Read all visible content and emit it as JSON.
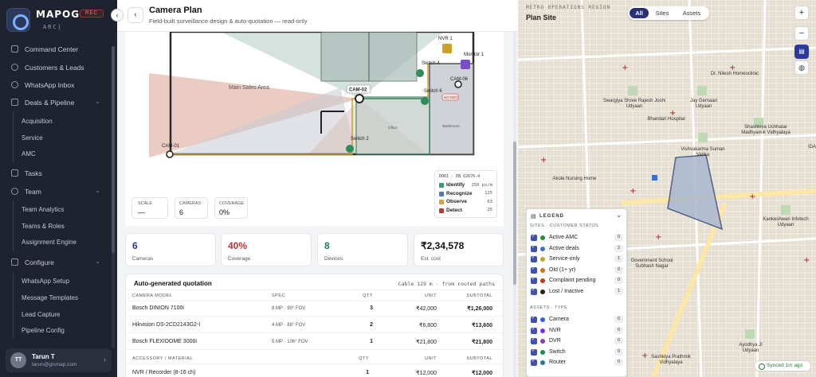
{
  "brand": {
    "name": "MAPOG",
    "badge": "REC",
    "sub": "ARC|"
  },
  "sidebar": {
    "items": [
      {
        "label": "Command Center"
      },
      {
        "label": "Customers & Leads"
      },
      {
        "label": "WhatsApp Inbox"
      },
      {
        "label": "Deals & Pipeline"
      },
      {
        "label": "Tasks"
      },
      {
        "label": "Team"
      },
      {
        "label": "Configure"
      }
    ],
    "deals_sub": [
      "Acquisition",
      "Service",
      "AMC"
    ],
    "team_sub": [
      "Team Analytics",
      "Teams & Roles",
      "Assignment Engine"
    ],
    "configure_sub": [
      "WhatsApp Setup",
      "Message Templates",
      "Lead Capture",
      "Pipeline Config"
    ]
  },
  "user": {
    "initials": "TT",
    "name": "Tarun T",
    "email": "tarun@gismap.com"
  },
  "header": {
    "title": "Camera Plan",
    "subtitle": "Field-built surveillance design & auto-quotation — read-only"
  },
  "plan": {
    "rooms": [
      "Main Sales Area",
      "Office",
      "Washroom"
    ],
    "cameras": [
      "CAM-01",
      "CAM-02",
      "CAM-06"
    ],
    "devices": [
      "NVR 1",
      "Monitor 1",
      "Switch 4",
      "Switch 6",
      "Switch 2"
    ],
    "rec_tag": "NO REC",
    "scale_label": "SCALE",
    "scale_value": "—",
    "cameras_label": "CAMERAS",
    "cameras_value": "6",
    "coverage_label": "COVERAGE",
    "coverage_value": "0%",
    "dori": {
      "title": "DORI · EN 62676-4",
      "rows": [
        {
          "name": "Identify",
          "value": "250 px/m",
          "color": "#3e9c74"
        },
        {
          "name": "Recognize",
          "value": "125",
          "color": "#4e79c7"
        },
        {
          "name": "Observe",
          "value": "63",
          "color": "#d4a23a"
        },
        {
          "name": "Detect",
          "value": "25",
          "color": "#b23b3b"
        }
      ]
    }
  },
  "kpis": [
    {
      "value": "6",
      "label": "Cameras",
      "color": "#2b3a9a"
    },
    {
      "value": "40%",
      "label": "Coverage",
      "color": "#b33a3a"
    },
    {
      "value": "8",
      "label": "Devices",
      "color": "#1f7a55"
    },
    {
      "value": "₹2,34,578",
      "label": "Est. cost",
      "color": "#111111"
    }
  ],
  "quotation": {
    "title": "Auto-generated quotation",
    "note": "Cable 129 m · from routed paths",
    "camera_headers": [
      "CAMERA MODEL",
      "SPEC",
      "QTY",
      "UNIT",
      "SUBTOTAL"
    ],
    "camera_rows": [
      [
        "Bosch DINION 7100i",
        "8 MP · 90° FOV",
        "3",
        "₹42,000",
        "₹1,26,000"
      ],
      [
        "Hikvision DS-2CD2143G2-I",
        "4 MP · 88° FOV",
        "2",
        "₹6,800",
        "₹13,600"
      ],
      [
        "Bosch FLEXIDOME 3000i",
        "5 MP · 106° FOV",
        "1",
        "₹21,800",
        "₹21,800"
      ]
    ],
    "accessory_headers": [
      "ACCESSORY / MATERIAL",
      "QTY",
      "UNIT",
      "SUBTOTAL"
    ],
    "accessory_rows": [
      [
        "NVR / Recorder (8-16 ch)",
        "1",
        "₹12,000",
        "₹12,000"
      ]
    ]
  },
  "map": {
    "region": "METRO OPERATIONS REGION",
    "title": "Plan Site",
    "tabs": [
      "All",
      "Sites",
      "Assets"
    ],
    "zoom_in": "+",
    "zoom_out": "−",
    "labels": [
      "Dr. Nilesh Homeoclinic",
      "Swargiya Shree Rajesh Joshi Udyaan",
      "Jay Gemaari Udyaan",
      "Bhandari Hospital",
      "Shashkiya Uchhatar Madhyamik Vidhyalaya",
      "Vishvakarma Suman Vatika",
      "Akole Nursing Home",
      "Kankeshwari Infotech Udyaan",
      "Government School Subhash Nagar",
      "Sashkiya Prathmik Vidhyalaya",
      "Ayodhya Ji Udyaan",
      "IDA"
    ],
    "synced": "Synced 1m ago"
  },
  "legend": {
    "title": "LEGEND",
    "sites_header": "SITES · CUSTOMER STATUS",
    "sites": [
      {
        "name": "Active AMC",
        "count": "0",
        "color": "#2e8b3e"
      },
      {
        "name": "Active deals",
        "count": "2",
        "color": "#3e6fcf"
      },
      {
        "name": "Service-only",
        "count": "1",
        "color": "#c9a227"
      },
      {
        "name": "Old (1+ yr)",
        "count": "0",
        "color": "#d0701e"
      },
      {
        "name": "Complaint pending",
        "count": "0",
        "color": "#c0392b"
      },
      {
        "name": "Lost / Inactive",
        "count": "1",
        "color": "#222222"
      }
    ],
    "assets_header": "ASSETS · TYPE",
    "assets": [
      {
        "name": "Camera",
        "count": "0",
        "color": "#3b5bdb"
      },
      {
        "name": "NVR",
        "count": "0",
        "color": "#7b2ff7"
      },
      {
        "name": "DVR",
        "count": "0",
        "color": "#8e3fa8"
      },
      {
        "name": "Switch",
        "count": "0",
        "color": "#1f8a5b"
      },
      {
        "name": "Router",
        "count": "0",
        "color": "#2277aa"
      }
    ]
  }
}
